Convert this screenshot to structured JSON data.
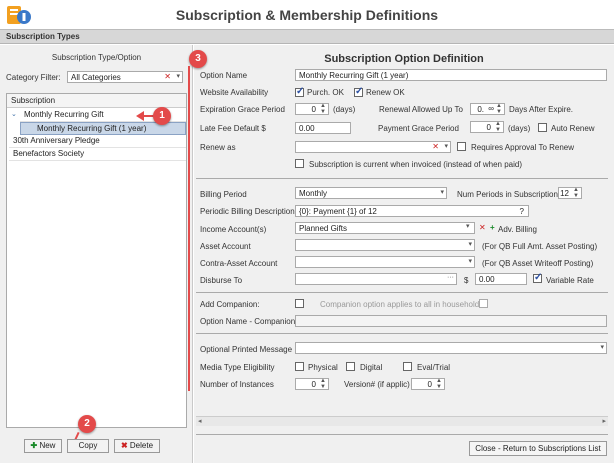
{
  "app": {
    "title": "Subscription & Membership Definitions"
  },
  "section": {
    "title": "Subscription Types"
  },
  "left": {
    "heading": "Subscription Type/Option",
    "category_filter_label": "Category Filter:",
    "category_filter_value": "All Categories",
    "tree_header": "Subscription",
    "items": [
      {
        "label": "Monthly Recurring Gift"
      },
      {
        "label": "Monthly Recurring Gift (1 year)"
      },
      {
        "label": "30th Anniversary Pledge"
      },
      {
        "label": "Benefactors Society"
      }
    ],
    "buttons": {
      "new": "New",
      "copy": "Copy",
      "delete": "Delete"
    }
  },
  "badges": {
    "b1": "1",
    "b2": "2",
    "b3": "3"
  },
  "form": {
    "title": "Subscription Option Definition",
    "option_name_label": "Option Name",
    "option_name_value": "Monthly Recurring Gift (1 year)",
    "website_label": "Website Availability",
    "purch_ok": "Purch. OK",
    "renew_ok": "Renew OK",
    "grace_label": "Expiration Grace Period",
    "grace_value": "0",
    "days": "(days)",
    "renewal_label": "Renewal Allowed Up To",
    "renewal_value": "0.",
    "renewal_inf": "∞",
    "days_after": "Days After Expire.",
    "late_fee_label": "Late Fee Default $",
    "late_fee_value": "0.00",
    "payment_grace_label": "Payment Grace Period",
    "payment_grace_value": "0",
    "auto_renew": "Auto Renew",
    "renew_as_label": "Renew as",
    "requires_approval": "Requires Approval To Renew",
    "current_when_invoiced": "Subscription is current when invoiced (instead of when paid)",
    "billing_period_label": "Billing Period",
    "billing_period_value": "Monthly",
    "num_periods_label": "Num Periods in Subscription",
    "num_periods_value": "12",
    "periodic_desc_label": "Periodic Billing Description:",
    "periodic_desc_value": "{0}: Payment {1} of 12",
    "periodic_q": "?",
    "income_label": "Income Account(s)",
    "income_value": "Planned Gifts",
    "adv_billing": "Adv. Billing",
    "asset_label": "Asset Account",
    "asset_note": "(For QB Full Amt. Asset Posting)",
    "contra_label": "Contra-Asset Account",
    "contra_note": "(For QB Asset Writeoff Posting)",
    "disburse_label": "Disburse To",
    "dollar": "$",
    "disburse_amount": "0.00",
    "variable_rate": "Variable Rate",
    "add_companion_label": "Add Companion:",
    "companion_note": "Companion option applies to all in household",
    "option_name_companion_label": "Option Name - Companion",
    "optional_msg_label": "Optional Printed Message",
    "media_label": "Media Type Eligibility",
    "physical": "Physical",
    "digital": "Digital",
    "eval": "Eval/Trial",
    "instances_label": "Number of Instances",
    "instances_value": "0",
    "version_label": "Version# (if applic)",
    "version_value": "0",
    "close_button": "Close - Return to Subscriptions List"
  },
  "colors": {
    "badge": "#e34a4a",
    "selected_row": "#c9d7e8"
  }
}
